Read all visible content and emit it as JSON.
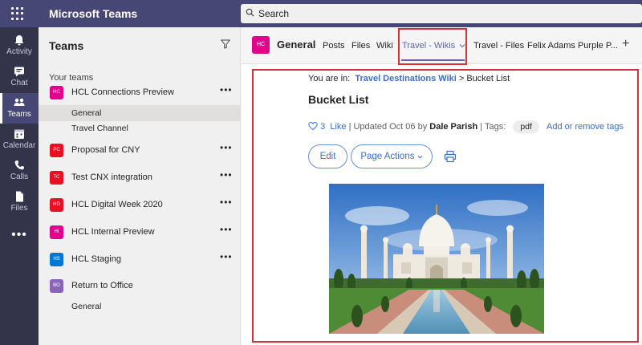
{
  "app": {
    "title": "Microsoft Teams"
  },
  "search": {
    "placeholder": "Search"
  },
  "rail": [
    {
      "label": "Activity",
      "icon": "bell-icon"
    },
    {
      "label": "Chat",
      "icon": "chat-icon"
    },
    {
      "label": "Teams",
      "icon": "teams-icon"
    },
    {
      "label": "Calendar",
      "icon": "calendar-icon"
    },
    {
      "label": "Calls",
      "icon": "phone-icon"
    },
    {
      "label": "Files",
      "icon": "file-icon"
    }
  ],
  "rail_more": "•••",
  "teams_panel": {
    "title": "Teams",
    "section": "Your teams",
    "more": "•••",
    "teams": [
      {
        "name": "HCL Connections Preview",
        "initials": "HC",
        "color": "#e3008c",
        "channels": [
          "General",
          "Travel Channel"
        ]
      },
      {
        "name": "Proposal for CNY",
        "initials": "PC",
        "color": "#e81123",
        "channels": []
      },
      {
        "name": "Test CNX integration",
        "initials": "TC",
        "color": "#e81123",
        "channels": []
      },
      {
        "name": "HCL Digital Week 2020",
        "initials": "HD",
        "color": "#e81123",
        "channels": []
      },
      {
        "name": "HCL Internal Preview",
        "initials": "HI",
        "color": "#e3008c",
        "channels": []
      },
      {
        "name": "HCL Staging",
        "initials": "HS",
        "color": "#0078d4",
        "channels": []
      },
      {
        "name": "Return to Office",
        "initials": "BO",
        "color": "#8764b8",
        "channels": [
          "General"
        ]
      }
    ]
  },
  "channel": {
    "initials": "HC",
    "name": "General",
    "tabs": [
      "Posts",
      "Files",
      "Wiki",
      "Travel - Wikis",
      "Travel - Files",
      "Felix Adams Purple P..."
    ],
    "add_tab": "+"
  },
  "page": {
    "crumb_prefix": "You are in:",
    "crumb_link": "Travel Destinations Wiki",
    "crumb_sep": ">",
    "crumb_current": "Bucket List",
    "title": "Bucket List",
    "like_count": "3",
    "like_label": "Like",
    "updated": "| Updated Oct 06 by",
    "author": "Dale Parish",
    "tags_label": "| Tags:",
    "tag": "pdf",
    "tag_action": "Add or remove tags",
    "edit_button": "Edit",
    "actions_button": "Page Actions"
  }
}
